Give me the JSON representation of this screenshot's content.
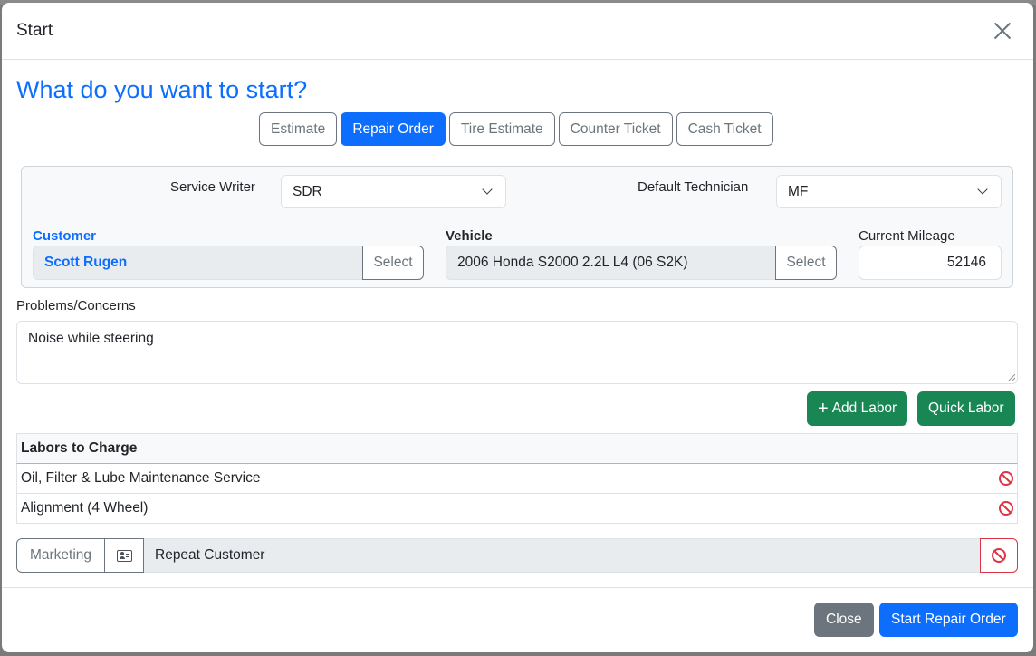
{
  "modal": {
    "title": "Start",
    "close_icon": "close-icon"
  },
  "headline": "What do you want to start?",
  "type_tabs": [
    {
      "label": "Estimate",
      "active": false
    },
    {
      "label": "Repair Order",
      "active": true
    },
    {
      "label": "Tire Estimate",
      "active": false
    },
    {
      "label": "Counter Ticket",
      "active": false
    },
    {
      "label": "Cash Ticket",
      "active": false
    }
  ],
  "info": {
    "service_writer_label": "Service Writer",
    "service_writer_value": "SDR",
    "default_technician_label": "Default Technician",
    "default_technician_value": "MF",
    "customer_label": "Customer",
    "customer_value": "Scott Rugen",
    "customer_select": "Select",
    "vehicle_label": "Vehicle",
    "vehicle_value": "2006 Honda S2000 2.2L L4 (06 S2K)",
    "vehicle_select": "Select",
    "mileage_label": "Current Mileage",
    "mileage_value": "52146"
  },
  "problems": {
    "label": "Problems/Concerns",
    "value": "Noise while steering"
  },
  "actions": {
    "add_labor": "Add Labor",
    "quick_labor": "Quick Labor"
  },
  "labors": {
    "header": "Labors to Charge",
    "items": [
      {
        "name": "Oil, Filter & Lube Maintenance Service"
      },
      {
        "name": "Alignment (4 Wheel)"
      }
    ]
  },
  "marketing": {
    "label": "Marketing",
    "value": "Repeat Customer"
  },
  "footer": {
    "close": "Close",
    "start": "Start Repair Order"
  },
  "colors": {
    "primary": "#0d6efd",
    "success": "#198754",
    "danger": "#dc3545",
    "secondary": "#6c757d"
  }
}
